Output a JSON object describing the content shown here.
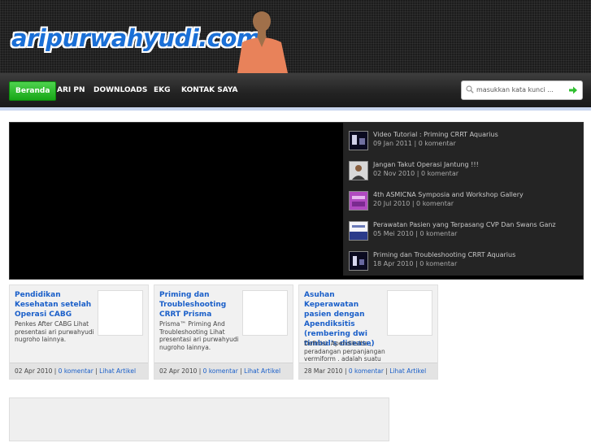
{
  "header": {
    "logo_text": "aripurwahyudi.com"
  },
  "nav": {
    "items": [
      {
        "label": "Beranda",
        "active": true
      },
      {
        "label": "ARI PN",
        "active": false
      },
      {
        "label": "DOWNLOADS",
        "active": false
      },
      {
        "label": "EKG",
        "active": false
      },
      {
        "label": "KONTAK SAYA",
        "active": false
      }
    ],
    "search_placeholder": "masukkan kata kunci ..."
  },
  "slider": {
    "items": [
      {
        "title": "Video Tutorial : Priming CRRT Aquarius",
        "meta": "09 Jan 2011 | 0 komentar"
      },
      {
        "title": "Jangan Takut Operasi Jantung !!!",
        "meta": "02 Nov 2010 | 0 komentar"
      },
      {
        "title": "4th ASMICNA Symposia and Workshop Gallery",
        "meta": "20 Jul 2010 | 0 komentar"
      },
      {
        "title": "Perawatan Pasien yang Terpasang CVP Dan Swans Ganz",
        "meta": "05 Mei 2010 | 0 komentar"
      },
      {
        "title": "Priming dan Troubleshooting CRRT Aquarius",
        "meta": "18 Apr 2010 | 0 komentar"
      }
    ]
  },
  "cards": [
    {
      "title": "Pendidikan Kesehatan setelah Operasi CABG",
      "excerpt": "Penkes After CABG Lihat presentasi ari purwahyudi nugroho   lainnya.",
      "date": "02 Apr 2010",
      "comments": "0 komentar",
      "link": "Lihat Artikel"
    },
    {
      "title": "Priming dan Troubleshooting CRRT Prisma",
      "excerpt": "Prisma™ Priming And Troubleshooting Lihat presentasi ari purwahyudi nugroho   lainnya.",
      "date": "02 Apr 2010",
      "comments": "0 komentar",
      "link": "Lihat Artikel"
    },
    {
      "title": "Asuhan Keperawatan pasien dengan Apendiksitis (rembering dwi timbul's disease)",
      "excerpt": "Definisi: Apendiksitis , peradangan perpanjangan vermiform , adalah suatu penyakit umum nyeri abdominal akut dan",
      "date": "28 Mar 2010",
      "comments": "0 komentar",
      "link": "Lihat Artikel"
    }
  ],
  "colors": {
    "accent": "#1a5fc9",
    "nav_active": "#17a617",
    "header_bg": "#1c1c1c"
  }
}
